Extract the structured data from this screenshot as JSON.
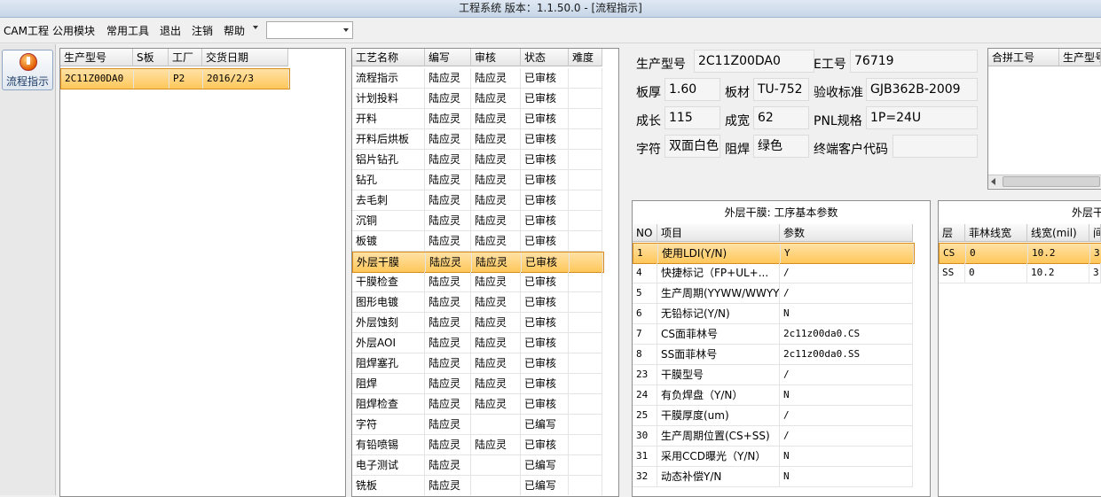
{
  "window": {
    "title": "工程系统    版本：1.1.50.0 - [流程指示]"
  },
  "menu": [
    "CAM工程",
    "公用模块",
    "常用工具",
    "退出",
    "注销",
    "帮助"
  ],
  "sidebar": {
    "flow_button": "流程指示"
  },
  "orders": {
    "headers": [
      "生产型号",
      "S板",
      "工厂",
      "交货日期"
    ],
    "rows": [
      [
        "2C11Z00DA0",
        "",
        "P2",
        "2016/2/3"
      ]
    ]
  },
  "process": {
    "headers": [
      "工艺名称",
      "编写",
      "审核",
      "状态",
      "难度"
    ],
    "selected_index": 9,
    "rows": [
      [
        "流程指示",
        "陆应灵",
        "陆应灵",
        "已审核",
        ""
      ],
      [
        "计划投料",
        "陆应灵",
        "陆应灵",
        "已审核",
        ""
      ],
      [
        "开料",
        "陆应灵",
        "陆应灵",
        "已审核",
        ""
      ],
      [
        "开料后烘板",
        "陆应灵",
        "陆应灵",
        "已审核",
        ""
      ],
      [
        "铝片钻孔",
        "陆应灵",
        "陆应灵",
        "已审核",
        ""
      ],
      [
        "钻孔",
        "陆应灵",
        "陆应灵",
        "已审核",
        ""
      ],
      [
        "去毛刺",
        "陆应灵",
        "陆应灵",
        "已审核",
        ""
      ],
      [
        "沉铜",
        "陆应灵",
        "陆应灵",
        "已审核",
        ""
      ],
      [
        "板镀",
        "陆应灵",
        "陆应灵",
        "已审核",
        ""
      ],
      [
        "外层干膜",
        "陆应灵",
        "陆应灵",
        "已审核",
        ""
      ],
      [
        "干膜检查",
        "陆应灵",
        "陆应灵",
        "已审核",
        ""
      ],
      [
        "图形电镀",
        "陆应灵",
        "陆应灵",
        "已审核",
        ""
      ],
      [
        "外层蚀刻",
        "陆应灵",
        "陆应灵",
        "已审核",
        ""
      ],
      [
        "外层AOI",
        "陆应灵",
        "陆应灵",
        "已审核",
        ""
      ],
      [
        "阻焊塞孔",
        "陆应灵",
        "陆应灵",
        "已审核",
        ""
      ],
      [
        "阻焊",
        "陆应灵",
        "陆应灵",
        "已审核",
        ""
      ],
      [
        "阻焊检查",
        "陆应灵",
        "陆应灵",
        "已审核",
        ""
      ],
      [
        "字符",
        "陆应灵",
        "",
        "已编写",
        ""
      ],
      [
        "有铅喷锡",
        "陆应灵",
        "陆应灵",
        "已审核",
        ""
      ],
      [
        "电子测试",
        "陆应灵",
        "",
        "已编写",
        ""
      ],
      [
        "铣板",
        "陆应灵",
        "",
        "已编写",
        ""
      ]
    ]
  },
  "info": {
    "model_label": "生产型号",
    "model_value": "2C11Z00DA0",
    "eno_label": "E工号",
    "eno_value": "76719",
    "thickness_label": "板厚",
    "thickness_value": "1.60",
    "material_label": "板材",
    "material_value": "TU-752",
    "standard_label": "验收标准",
    "standard_value": "GJB362B-2009",
    "length_label": "成长",
    "length_value": "115",
    "width_label": "成宽",
    "width_value": "62",
    "pnl_label": "PNL规格",
    "pnl_value": "1P=24U",
    "char_label": "字符",
    "char_value": "双面白色",
    "mask_label": "阻焊",
    "mask_value": "绿色",
    "customer_label": "终端客户代码",
    "customer_value": ""
  },
  "combine": {
    "headers": [
      "合拼工号",
      "生产型号"
    ]
  },
  "params": {
    "title": "外层干膜: 工序基本参数",
    "headers": [
      "NO",
      "项目",
      "参数"
    ],
    "selected_index": 0,
    "rows": [
      [
        "1",
        "使用LDI(Y/N)",
        "Y"
      ],
      [
        "4",
        "快捷标记（FP+UL+...",
        "/"
      ],
      [
        "5",
        "生产周期(YYWW/WWYY)",
        "/"
      ],
      [
        "6",
        "无铅标记(Y/N)",
        "N"
      ],
      [
        "7",
        "CS面菲林号",
        "2c11z00da0.CS"
      ],
      [
        "8",
        "SS面菲林号",
        "2c11z00da0.SS"
      ],
      [
        "23",
        "干膜型号",
        "/"
      ],
      [
        "24",
        "有负焊盘（Y/N）",
        "N"
      ],
      [
        "25",
        "干膜厚度(um)",
        "/"
      ],
      [
        "30",
        "生产周期位置(CS+SS)",
        "/"
      ],
      [
        "31",
        "采用CCD曝光（Y/N）",
        "N"
      ],
      [
        "32",
        "动态补偿Y/N",
        "N"
      ]
    ]
  },
  "layers": {
    "title": "外层干",
    "headers": [
      "层",
      "菲林线宽",
      "线宽(mil)",
      "间"
    ],
    "selected_index": 0,
    "rows": [
      [
        "CS",
        "0",
        "10.2",
        "3"
      ],
      [
        "SS",
        "0",
        "10.2",
        "3"
      ]
    ]
  }
}
